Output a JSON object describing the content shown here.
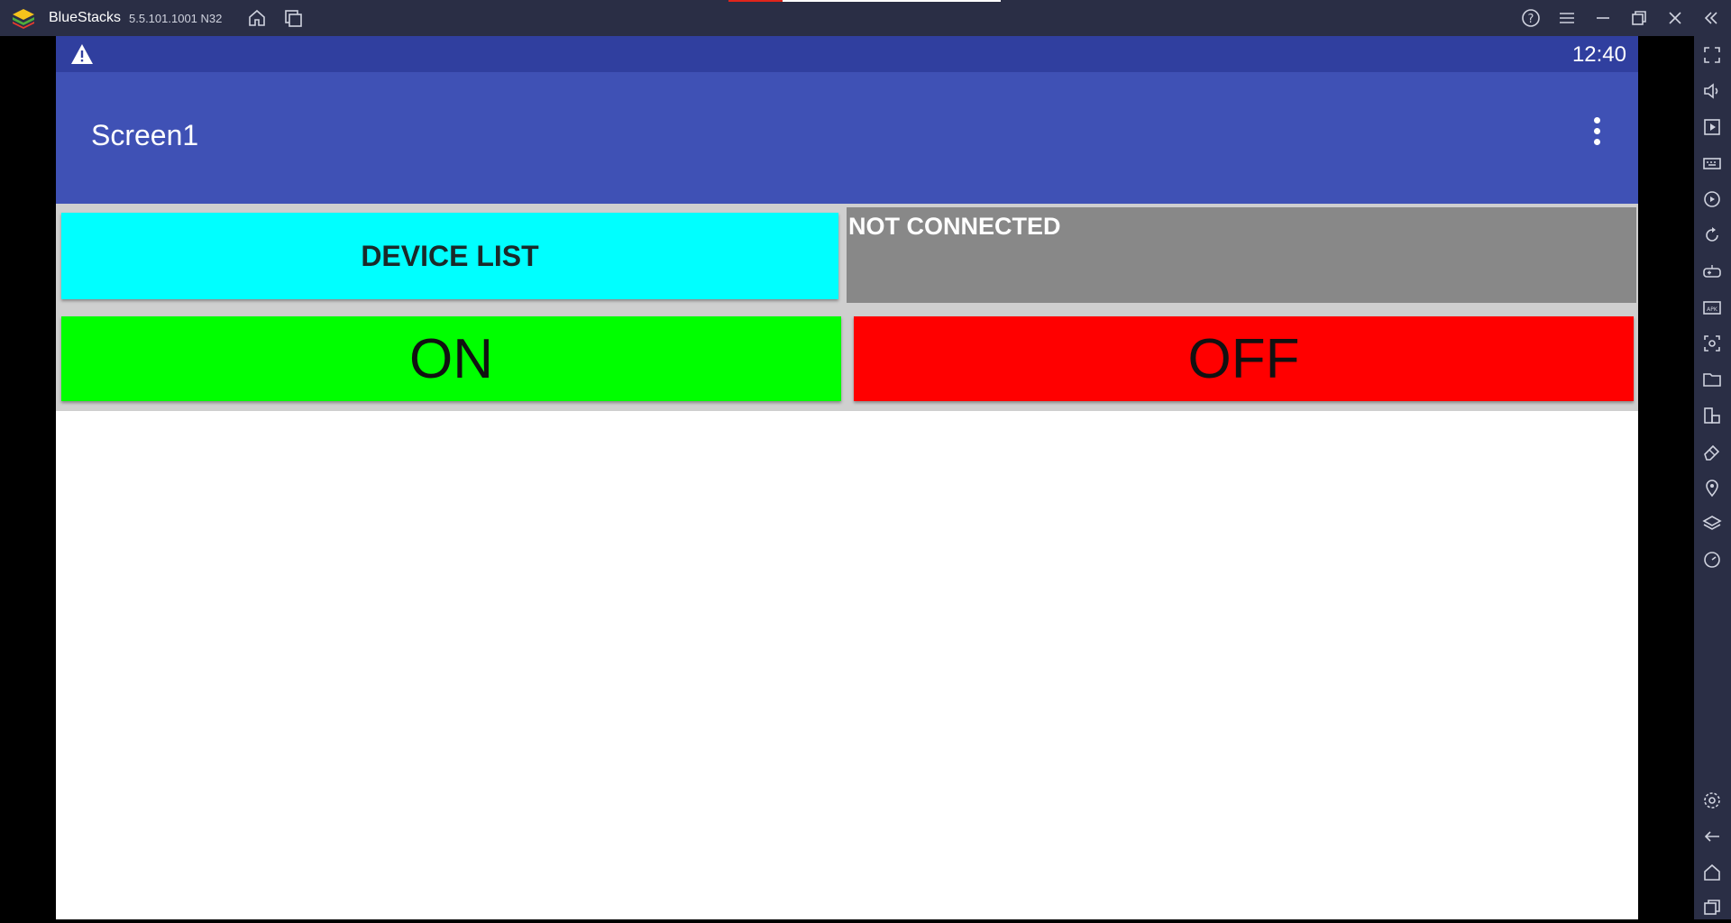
{
  "window": {
    "app_name": "BlueStacks",
    "version": "5.5.101.1001 N32"
  },
  "titlebar_icons": [
    "home-icon",
    "multi-instance-icon",
    "help-icon",
    "menu-icon",
    "minimize-icon",
    "restore-icon",
    "close-icon",
    "collapse-sidebar-icon"
  ],
  "android": {
    "status_bar": {
      "warning_icon": "warning-icon",
      "time": "12:40"
    },
    "app_bar": {
      "title": "Screen1",
      "overflow_icon": "more-vert-icon"
    },
    "controls": {
      "device_list_label": "DEVICE LIST",
      "connection_status": "NOT CONNECTED",
      "on_label": "ON",
      "off_label": "OFF"
    },
    "colors": {
      "status_bar": "#303f9f",
      "app_bar": "#3f51b5",
      "device_list": "#00ffff",
      "status_label": "#888888",
      "on": "#00ff00",
      "off": "#ff0000"
    }
  },
  "sidebar_icons": [
    "fullscreen-icon",
    "volume-icon",
    "media-icon",
    "keyboard-icon",
    "record-icon",
    "rotate-icon",
    "gamepad-icon",
    "apk-icon",
    "screenshot-icon",
    "folder-icon",
    "multi-resize-icon",
    "eraser-icon",
    "location-icon",
    "layers-icon",
    "speed-icon",
    "settings-icon",
    "back-icon",
    "android-home-icon",
    "recents-icon"
  ]
}
